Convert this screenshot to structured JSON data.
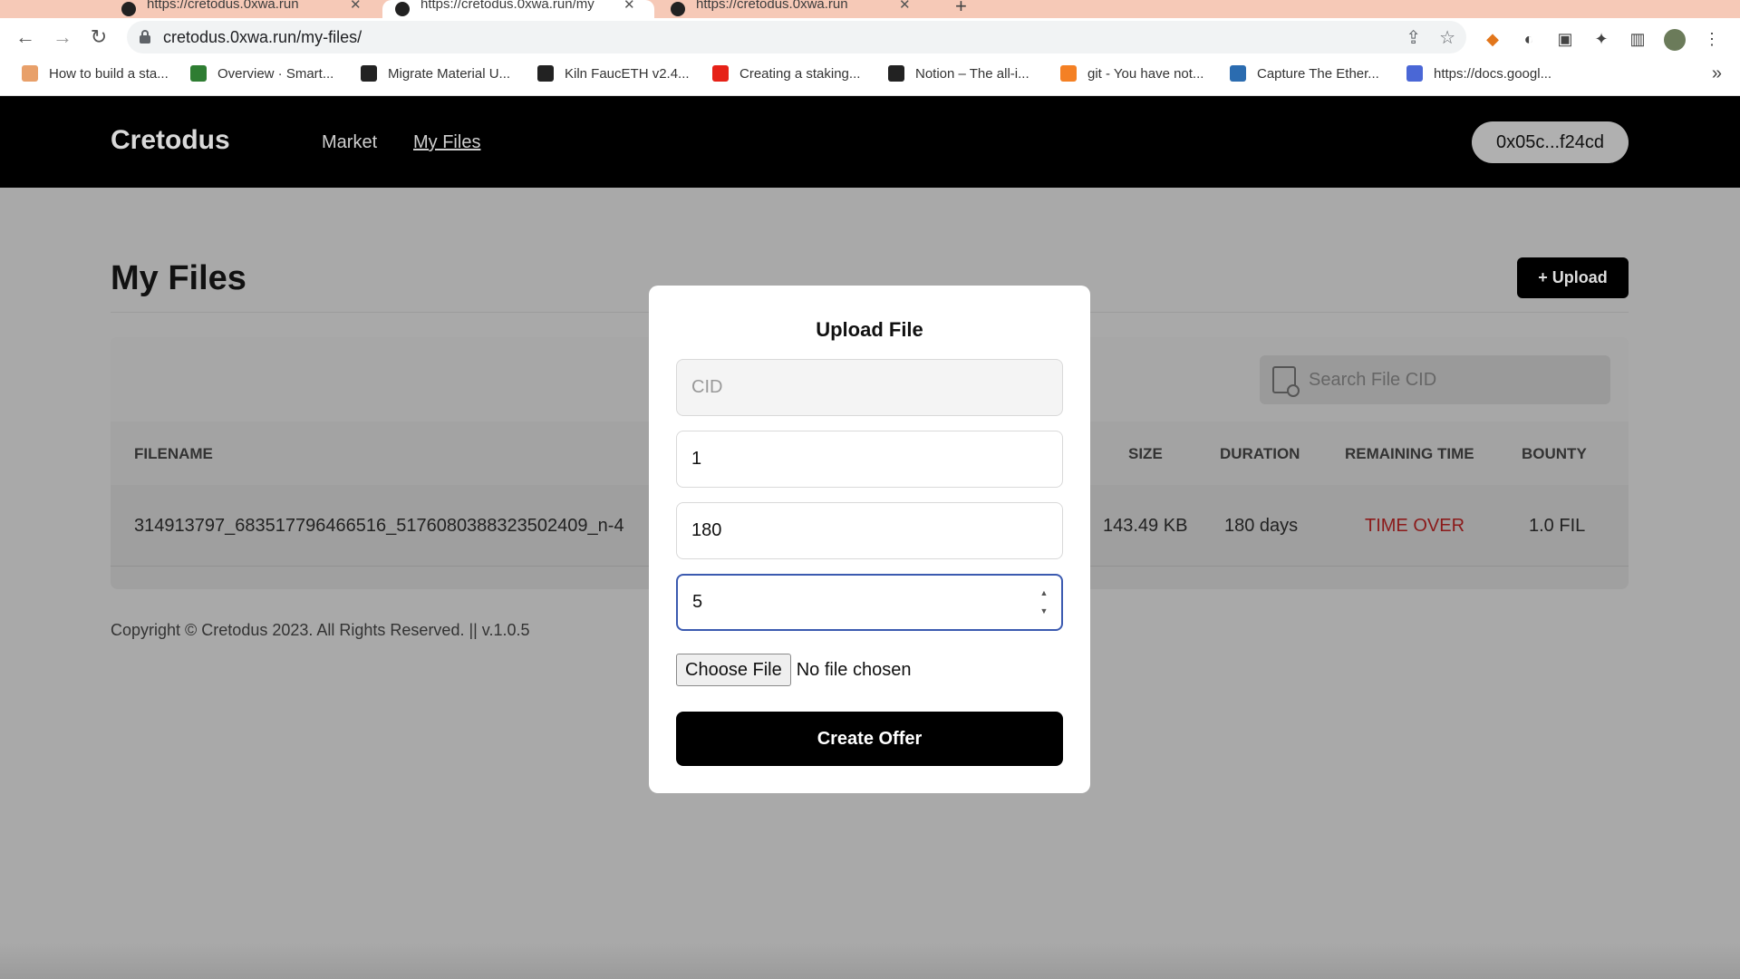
{
  "browser": {
    "tabs": [
      {
        "title": "https://cretodus.0xwa.run",
        "active": false
      },
      {
        "title": "https://cretodus.0xwa.run/my",
        "active": true
      },
      {
        "title": "https://cretodus.0xwa.run",
        "active": false
      }
    ],
    "url": "cretodus.0xwa.run/my-files/",
    "bookmarks": [
      {
        "label": "How to build a sta...",
        "icon_color": "#e8a06a"
      },
      {
        "label": "Overview · Smart...",
        "icon_color": "#2e7d32"
      },
      {
        "label": "Migrate Material U...",
        "icon_color": "#222222"
      },
      {
        "label": "Kiln FaucETH v2.4...",
        "icon_color": "#222222"
      },
      {
        "label": "Creating a staking...",
        "icon_color": "#e62117"
      },
      {
        "label": "Notion – The all-i...",
        "icon_color": "#222222"
      },
      {
        "label": "git - You have not...",
        "icon_color": "#f48024"
      },
      {
        "label": "Capture The Ether...",
        "icon_color": "#2b6cb0"
      },
      {
        "label": "https://docs.googl...",
        "icon_color": "#4a67d6"
      }
    ]
  },
  "header": {
    "brand": "Cretodus",
    "nav": [
      {
        "label": "Market",
        "current": false
      },
      {
        "label": "My Files",
        "current": true
      }
    ],
    "wallet": "0x05c...f24cd"
  },
  "main": {
    "title": "My Files",
    "upload_label": "+ Upload",
    "search_placeholder": "Search File CID",
    "columns": [
      "FILENAME",
      "SIZE",
      "DURATION",
      "REMAINING TIME",
      "BOUNTY"
    ],
    "rows": [
      {
        "filename": "314913797_683517796466516_5176080388323502409_n-4",
        "size": "143.49 KB",
        "duration": "180 days",
        "remaining": "TIME OVER",
        "bounty": "1.0 FIL"
      }
    ],
    "footer": "Copyright © Cretodus 2023. All Rights Reserved. || v.1.0.5"
  },
  "modal": {
    "title": "Upload File",
    "cid_placeholder": "CID",
    "field2_value": "1",
    "field3_value": "180",
    "field4_value": "5",
    "choose_file_label": "Choose File",
    "file_status": "No file chosen",
    "submit_label": "Create Offer"
  },
  "colors": {
    "accent_focus": "#3b5ab0",
    "time_over": "#8b1a1a",
    "overlay": "#a9a9a9"
  }
}
